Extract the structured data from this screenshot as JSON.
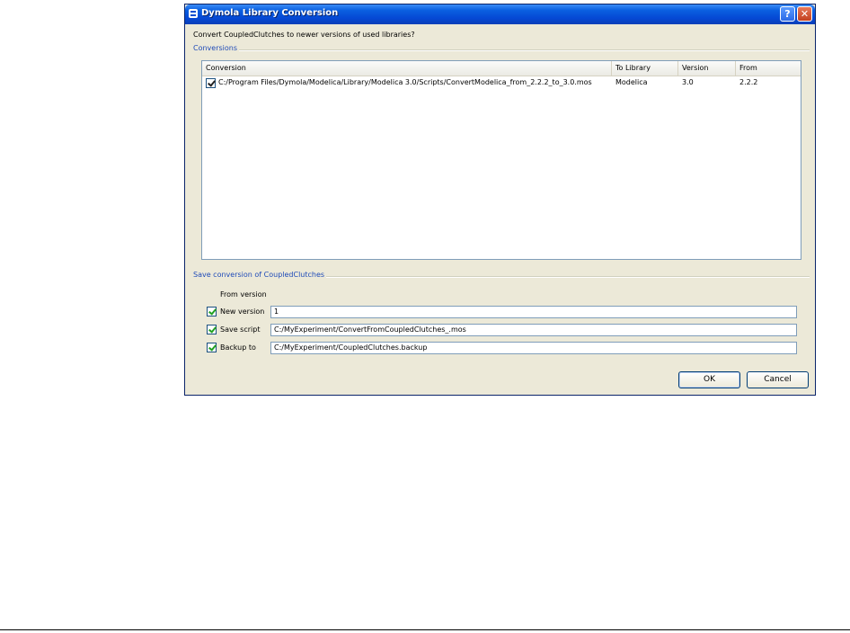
{
  "window": {
    "title": "Dymola Library Conversion",
    "help": "?",
    "close": "✕"
  },
  "prompt": "Convert CoupledClutches to newer versions of used libraries?",
  "conversions": {
    "group_title": "Conversions",
    "columns": [
      "Conversion",
      "To Library",
      "Version",
      "From"
    ],
    "rows": [
      {
        "checked": true,
        "conversion": "C:/Program Files/Dymola/Modelica/Library/Modelica 3.0/Scripts/ConvertModelica_from_2.2.2_to_3.0.mos",
        "to_library": "Modelica",
        "version": "3.0",
        "from": "2.2.2"
      }
    ]
  },
  "save": {
    "group_title": "Save conversion of CoupledClutches",
    "from_version_label": "From version",
    "new_version": {
      "label": "New version",
      "checked": true,
      "value": "1"
    },
    "save_script": {
      "label": "Save script",
      "checked": true,
      "value": "C:/MyExperiment/ConvertFromCoupledClutches_.mos"
    },
    "backup_to": {
      "label": "Backup to",
      "checked": true,
      "value": "C:/MyExperiment/CoupledClutches.backup"
    }
  },
  "buttons": {
    "ok": "OK",
    "cancel": "Cancel"
  }
}
